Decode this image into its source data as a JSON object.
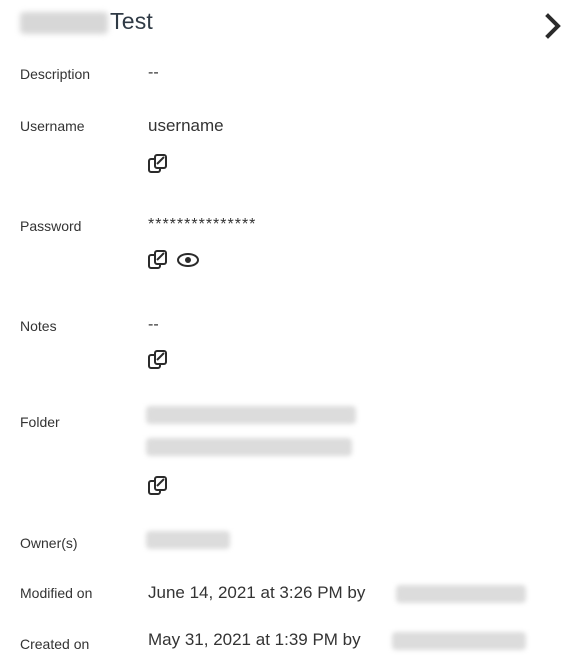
{
  "header": {
    "title": "Test",
    "next_icon": "chevron-right-icon"
  },
  "fields": {
    "description": {
      "label": "Description",
      "value": "--"
    },
    "username": {
      "label": "Username",
      "value": "username",
      "copy_icon": "copy-icon"
    },
    "password": {
      "label": "Password",
      "value": "***************",
      "copy_icon": "copy-icon",
      "reveal_icon": "eye-icon"
    },
    "notes": {
      "label": "Notes",
      "value": "--",
      "copy_icon": "copy-icon"
    },
    "folder": {
      "label": "Folder",
      "copy_icon": "copy-icon"
    },
    "owners": {
      "label": "Owner(s)"
    },
    "modified": {
      "label": "Modified on",
      "value": "June 14, 2021 at 3:26 PM by"
    },
    "created": {
      "label": "Created on",
      "value": "May 31, 2021 at 1:39 PM by"
    }
  }
}
